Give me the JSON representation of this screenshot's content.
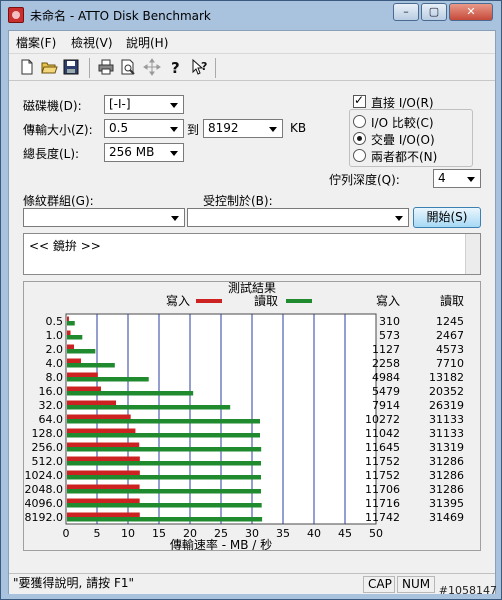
{
  "window": {
    "title": "未命名 - ATTO Disk Benchmark",
    "min_glyph": "–",
    "max_glyph": "▢",
    "close_glyph": "✕"
  },
  "menu": [
    "檔案(F)",
    "檢視(V)",
    "說明(H)"
  ],
  "toolbar_icons": [
    "new-file-icon",
    "open-folder-icon",
    "save-icon",
    "print-icon",
    "print-preview-icon",
    "move-icon",
    "help-icon",
    "context-help-icon"
  ],
  "settings": {
    "drive_label": "磁碟機(D):",
    "drive_value": "[-I-]",
    "transfer_label": "傳輸大小(Z):",
    "transfer_from": "0.5",
    "to_label": "到",
    "transfer_to": "8192",
    "kb_label": "KB",
    "length_label": "總長度(L):",
    "length_value": "256 MB",
    "direct_io_label": "直接 I/O(R)",
    "direct_io_checked": true,
    "io_options": [
      {
        "label": "I/O 比較(C)",
        "selected": false
      },
      {
        "label": "交疊 I/O(O)",
        "selected": true
      },
      {
        "label": "兩者都不(N)",
        "selected": false
      }
    ],
    "queue_label": "佇列深度(Q):",
    "queue_value": "4",
    "pattern_label": "條紋群組(G):",
    "pattern_value": "",
    "controlled_label": "受控制於(B):",
    "controlled_value": "",
    "start_label": "開始(S)"
  },
  "notes_text": "<< 鏡拚 >>",
  "chart_data": {
    "type": "bar",
    "title": "測試結果",
    "xlabel": "傳輸速率 - MB / 秒",
    "xlim": [
      0,
      50
    ],
    "xticks": [
      0,
      5,
      10,
      15,
      20,
      25,
      30,
      35,
      40,
      45,
      50
    ],
    "categories": [
      "0.5",
      "1.0",
      "2.0",
      "4.0",
      "8.0",
      "16.0",
      "32.0",
      "64.0",
      "128.0",
      "256.0",
      "512.0",
      "1024.0",
      "2048.0",
      "4096.0",
      "8192.0"
    ],
    "series": [
      {
        "name": "寫入",
        "color": "#cc2222",
        "values": [
          0.31,
          0.57,
          1.13,
          2.26,
          4.98,
          5.48,
          7.91,
          10.27,
          11.04,
          11.65,
          11.75,
          11.75,
          11.71,
          11.72,
          11.74
        ]
      },
      {
        "name": "讀取",
        "color": "#1f8a2e",
        "values": [
          1.25,
          2.47,
          4.57,
          7.71,
          13.18,
          20.35,
          26.32,
          31.13,
          31.13,
          31.32,
          31.29,
          31.29,
          31.29,
          31.4,
          31.47
        ]
      }
    ],
    "write_header": "寫入",
    "read_header": "讀取",
    "write_values": [
      "310",
      "573",
      "1127",
      "2258",
      "4984",
      "5479",
      "7914",
      "10272",
      "11042",
      "11645",
      "11752",
      "11752",
      "11706",
      "11716",
      "11742"
    ],
    "read_values": [
      "1245",
      "2467",
      "4573",
      "7710",
      "13182",
      "20352",
      "26319",
      "31133",
      "31133",
      "31319",
      "31286",
      "31286",
      "31286",
      "31395",
      "31469"
    ]
  },
  "status": {
    "help_text": "\"要獲得說明, 請按 F1\"",
    "cap": "CAP",
    "num": "NUM"
  },
  "watermark": "#1058147"
}
